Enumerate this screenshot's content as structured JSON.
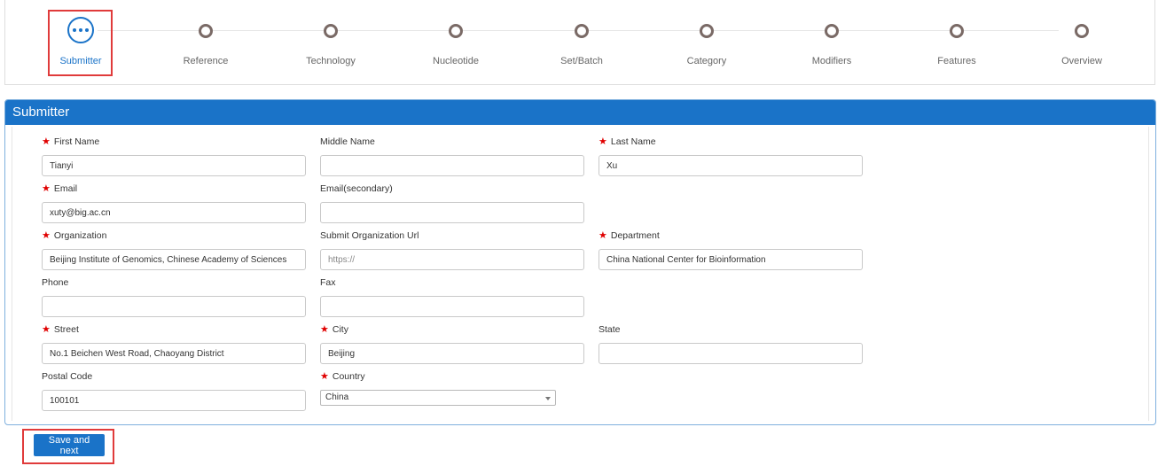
{
  "steps": [
    {
      "label": "Submitter",
      "state": "active"
    },
    {
      "label": "Reference",
      "state": "pending"
    },
    {
      "label": "Technology",
      "state": "pending"
    },
    {
      "label": "Nucleotide",
      "state": "pending"
    },
    {
      "label": "Set/Batch",
      "state": "pending"
    },
    {
      "label": "Category",
      "state": "pending"
    },
    {
      "label": "Modifiers",
      "state": "pending"
    },
    {
      "label": "Features",
      "state": "pending"
    },
    {
      "label": "Overview",
      "state": "pending"
    }
  ],
  "panel": {
    "title": "Submitter"
  },
  "form": {
    "first_name": {
      "label": "First Name",
      "value": "Tianyi",
      "required": true
    },
    "middle_name": {
      "label": "Middle Name",
      "value": "",
      "required": false
    },
    "last_name": {
      "label": "Last Name",
      "value": "Xu",
      "required": true
    },
    "email": {
      "label": "Email",
      "value": "xuty@big.ac.cn",
      "required": true
    },
    "email_secondary": {
      "label": "Email(secondary)",
      "value": "",
      "required": false
    },
    "organization": {
      "label": "Organization",
      "value": "Beijing Institute of Genomics, Chinese Academy of Sciences",
      "required": true
    },
    "org_url": {
      "label": "Submit Organization Url",
      "value": "",
      "placeholder": "https://",
      "required": false
    },
    "department": {
      "label": "Department",
      "value": "China National Center for Bioinformation",
      "required": true
    },
    "phone": {
      "label": "Phone",
      "value": "",
      "required": false
    },
    "fax": {
      "label": "Fax",
      "value": "",
      "required": false
    },
    "street": {
      "label": "Street",
      "value": "No.1 Beichen West Road, Chaoyang District",
      "required": true
    },
    "city": {
      "label": "City",
      "value": "Beijing",
      "required": true
    },
    "state": {
      "label": "State",
      "value": "",
      "required": false
    },
    "postal_code": {
      "label": "Postal Code",
      "value": "100101",
      "required": false
    },
    "country": {
      "label": "Country",
      "value": "China",
      "required": true
    }
  },
  "actions": {
    "save_next": "Save and next"
  },
  "colors": {
    "accent": "#1a73c8",
    "highlight": "#e03b3b",
    "required": "#e00000"
  }
}
